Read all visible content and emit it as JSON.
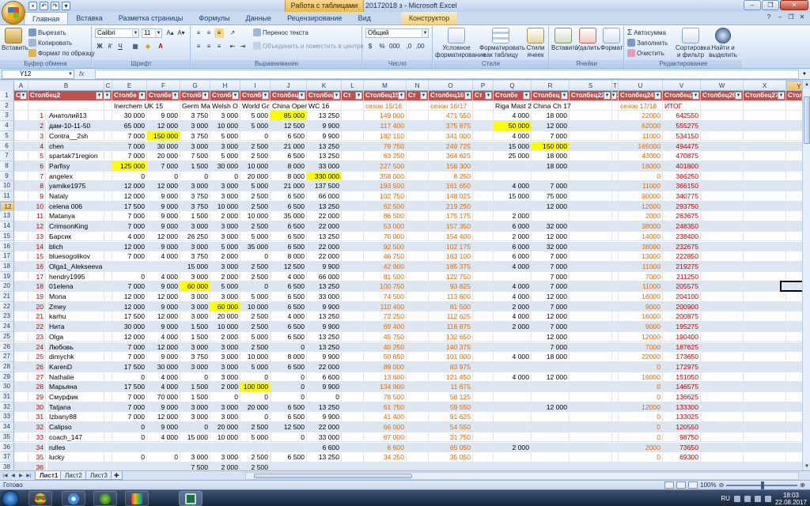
{
  "window": {
    "title": "20172018 з - Microsoft Excel",
    "context_tab_group": "Работа с таблицами"
  },
  "qat": [
    "save-icon",
    "undo-icon",
    "redo-icon",
    "dropdown-icon"
  ],
  "tabs": [
    {
      "label": "Главная",
      "active": true
    },
    {
      "label": "Вставка"
    },
    {
      "label": "Разметка страницы"
    },
    {
      "label": "Формулы"
    },
    {
      "label": "Данные"
    },
    {
      "label": "Рецензирование"
    },
    {
      "label": "Вид"
    },
    {
      "label": "Конструктор",
      "context": true
    }
  ],
  "ribbon": {
    "clipboard": {
      "title": "Буфер обмена",
      "paste": "Вставить",
      "cut": "Вырезать",
      "copy": "Копировать",
      "format_painter": "Формат по образцу"
    },
    "font": {
      "title": "Шрифт",
      "family": "Calibri",
      "size": "11",
      "bold": "Ж",
      "italic": "К",
      "underline": "Ч"
    },
    "alignment": {
      "title": "Выравнивание",
      "wrap": "Перенос текста",
      "merge": "Объединить и поместить в центре"
    },
    "number": {
      "title": "Число",
      "format": "Общий"
    },
    "styles": {
      "title": "Стили",
      "conditional": "Условное форматирование",
      "table": "Форматировать как таблицу",
      "cell_styles": "Стили ячеек"
    },
    "cells": {
      "title": "Ячейки",
      "insert": "Вставить",
      "delete": "Удалить",
      "format": "Формат"
    },
    "editing": {
      "title": "Редактирование",
      "autosum": "Автосумма",
      "fill": "Заполнить",
      "clear": "Очистить",
      "sort": "Сортировка и фильтр",
      "find": "Найти и выделить"
    }
  },
  "formula_bar": {
    "name_box": "Y12",
    "fx": "fx",
    "value": ""
  },
  "columns": [
    "A",
    "B",
    "C",
    "E",
    "F",
    "G",
    "H",
    "I",
    "J",
    "K",
    "L",
    "M",
    "N",
    "O",
    "P",
    "Q",
    "R",
    "S",
    "T",
    "U",
    "V",
    "W",
    "X",
    "Y"
  ],
  "header_row": [
    "Ст",
    "Столбец2",
    "С",
    "Столбе",
    "Столбе",
    "Столбе",
    "Столбе",
    "Столбе",
    "Столбец",
    "Столбец",
    "Ст",
    "Столбец15",
    "Ст",
    "Столбец16",
    "Ст",
    "Столбе",
    "Столбец",
    "Столбец22",
    "Ст",
    "Столбец24",
    "Столбец25",
    "Столбец26",
    "Столбец27",
    "Столб"
  ],
  "tournament_row": [
    "",
    "",
    "",
    "Inerchem UK 15",
    "",
    "Germ Ma",
    "Welsh O",
    "World Gr",
    "China Oper",
    "WC 16",
    "",
    "сезон 15/16",
    "",
    "сезон 16/17",
    "",
    "Riga Mast 2",
    "China Ch 17",
    "",
    "",
    "сезон 17/18",
    "ИТОГ",
    "",
    "",
    ""
  ],
  "rows": [
    {
      "n": "3",
      "id": "1",
      "name": "Анатолий13",
      "e": "30 000",
      "f": "9 000",
      "g": "3 750",
      "h": "3 000",
      "i": "5 000",
      "j": "85 000",
      "k": "13 250",
      "m": "149 000",
      "o": "471 550",
      "q": "4 000",
      "r": "18 000",
      "u": "22000",
      "v": "642550"
    },
    {
      "n": "4",
      "id": "2",
      "name": "дам-10-11-50",
      "e": "65 000",
      "f": "12 000",
      "g": "3 000",
      "h": "10 000",
      "i": "5 000",
      "j": "12 500",
      "k": "9 900",
      "m": "117 400",
      "o": "375 875",
      "q": "50 000",
      "r": "12 000",
      "u": "62000",
      "v": "555275"
    },
    {
      "n": "5",
      "id": "3",
      "name": "Contra__2sh",
      "e": "7 000",
      "f": "150 000",
      "g": "3 750",
      "h": "5 000",
      "i": "0",
      "j": "6 500",
      "k": "9 900",
      "m": "182 150",
      "o": "341 000",
      "q": "4 000",
      "r": "7 000",
      "u": "11000",
      "v": "534150"
    },
    {
      "n": "6",
      "id": "4",
      "name": "chen",
      "e": "7 000",
      "f": "30 000",
      "g": "3 000",
      "h": "3 000",
      "i": "2 500",
      "j": "21 000",
      "k": "13 250",
      "m": "79 750",
      "o": "249 725",
      "q": "15 000",
      "r": "150 000",
      "u": "165000",
      "v": "494475"
    },
    {
      "n": "7",
      "id": "5",
      "name": "spartak71region",
      "e": "7 000",
      "f": "20 000",
      "g": "7 500",
      "h": "5 000",
      "i": "2 500",
      "j": "6 500",
      "k": "13 250",
      "m": "63 250",
      "o": "364 625",
      "q": "25 000",
      "r": "18 000",
      "u": "43000",
      "v": "470875"
    },
    {
      "n": "8",
      "id": "6",
      "name": "Parfisy",
      "e": "125 000",
      "f": "7 000",
      "g": "1 500",
      "h": "30 000",
      "i": "10 000",
      "j": "8 000",
      "k": "33 000",
      "m": "227 500",
      "o": "156 300",
      "q": "",
      "r": "18 000",
      "u": "18000",
      "v": "401800"
    },
    {
      "n": "9",
      "id": "7",
      "name": "angelex",
      "e": "0",
      "f": "0",
      "g": "0",
      "h": "0",
      "i": "20 000",
      "j": "8 000",
      "k": "330 000",
      "m": "358 000",
      "o": "8 250",
      "q": "",
      "r": "",
      "u": "0",
      "v": "366250"
    },
    {
      "n": "10",
      "id": "8",
      "name": "yamike1975",
      "e": "12 000",
      "f": "12 000",
      "g": "3 000",
      "h": "3 000",
      "i": "5 000",
      "j": "21 000",
      "k": "137 500",
      "m": "193 500",
      "o": "161 650",
      "q": "4 000",
      "r": "7 000",
      "u": "11000",
      "v": "366150"
    },
    {
      "n": "11",
      "id": "9",
      "name": "Nataly",
      "e": "12 000",
      "f": "9 000",
      "g": "3 750",
      "h": "3 000",
      "i": "2 500",
      "j": "6 500",
      "k": "66 000",
      "m": "102 750",
      "o": "148 025",
      "q": "15 000",
      "r": "75 000",
      "u": "90000",
      "v": "340775"
    },
    {
      "n": "12",
      "id": "10",
      "name": "celena 006",
      "e": "17 500",
      "f": "9 000",
      "g": "3 750",
      "h": "10 000",
      "i": "2 500",
      "j": "6 500",
      "k": "13 250",
      "m": "62 500",
      "o": "219 250",
      "q": "",
      "r": "12 000",
      "u": "12000",
      "v": "293750"
    },
    {
      "n": "13",
      "id": "11",
      "name": "Matanya",
      "e": "7 000",
      "f": "9 000",
      "g": "1 500",
      "h": "2 000",
      "i": "10 000",
      "j": "35 000",
      "k": "22 000",
      "m": "86 500",
      "o": "175 175",
      "q": "2 000",
      "r": "",
      "u": "2000",
      "v": "263675"
    },
    {
      "n": "14",
      "id": "12",
      "name": "CrimsonKing",
      "e": "7 000",
      "f": "9 000",
      "g": "3 000",
      "h": "3 000",
      "i": "2 500",
      "j": "6 500",
      "k": "22 000",
      "m": "53 000",
      "o": "157 350",
      "q": "6 000",
      "r": "32 000",
      "u": "38000",
      "v": "248350"
    },
    {
      "n": "15",
      "id": "13",
      "name": "Барсик",
      "e": "4 000",
      "f": "12 000",
      "g": "26 250",
      "h": "3 000",
      "i": "5 000",
      "j": "6 500",
      "k": "13 250",
      "m": "70 000",
      "o": "154 400",
      "q": "2 000",
      "r": "12 000",
      "u": "14000",
      "v": "238400"
    },
    {
      "n": "16",
      "id": "14",
      "name": "blich",
      "e": "12 000",
      "f": "9 000",
      "g": "3 000",
      "h": "5 000",
      "i": "35 000",
      "j": "6 500",
      "k": "22 000",
      "m": "92 500",
      "o": "102 175",
      "q": "6 000",
      "r": "32 000",
      "u": "38000",
      "v": "232675"
    },
    {
      "n": "17",
      "id": "15",
      "name": "bluesogolikov",
      "e": "7 000",
      "f": "4 000",
      "g": "3 750",
      "h": "2 000",
      "i": "0",
      "j": "8 000",
      "k": "22 000",
      "m": "46 750",
      "o": "163 100",
      "q": "6 000",
      "r": "7 000",
      "u": "13000",
      "v": "222850"
    },
    {
      "n": "18",
      "id": "16",
      "name": "Olga1_Alekseeva",
      "e": "",
      "f": "",
      "g": "15 000",
      "h": "3 000",
      "i": "2 500",
      "j": "12 500",
      "k": "9 900",
      "m": "42 900",
      "o": "165 375",
      "q": "4 000",
      "r": "7 000",
      "u": "11000",
      "v": "219275"
    },
    {
      "n": "19",
      "id": "17",
      "name": "hendry1995",
      "e": "0",
      "f": "4 000",
      "g": "3 000",
      "h": "2 000",
      "i": "2 500",
      "j": "4 000",
      "k": "66 000",
      "m": "81 500",
      "o": "122 750",
      "q": "",
      "r": "7 000",
      "u": "7000",
      "v": "211250"
    },
    {
      "n": "20",
      "id": "18",
      "name": "01elena",
      "e": "7 000",
      "f": "9 000",
      "g": "60 000",
      "h": "5 000",
      "i": "0",
      "j": "6 500",
      "k": "13 250",
      "m": "100 750",
      "o": "93 825",
      "q": "4 000",
      "r": "7 000",
      "u": "11000",
      "v": "205575"
    },
    {
      "n": "21",
      "id": "19",
      "name": "Mona",
      "e": "12 000",
      "f": "12 000",
      "g": "3 000",
      "h": "3 000",
      "i": "5 000",
      "j": "6 500",
      "k": "33 000",
      "m": "74 500",
      "o": "113 600",
      "q": "4 000",
      "r": "12 000",
      "u": "16000",
      "v": "204100"
    },
    {
      "n": "22",
      "id": "20",
      "name": "Zmey",
      "e": "12 000",
      "f": "9 000",
      "g": "3 000",
      "h": "60 000",
      "i": "10 000",
      "j": "6 500",
      "k": "9 900",
      "m": "110 400",
      "o": "81 500",
      "q": "2 000",
      "r": "7 000",
      "u": "9000",
      "v": "200900"
    },
    {
      "n": "23",
      "id": "21",
      "name": "karhu",
      "e": "17 500",
      "f": "12 000",
      "g": "3 000",
      "h": "20 000",
      "i": "2 500",
      "j": "4 000",
      "k": "13 250",
      "m": "72 250",
      "o": "112 625",
      "q": "4 000",
      "r": "12 000",
      "u": "16000",
      "v": "200875"
    },
    {
      "n": "24",
      "id": "22",
      "name": "Нита",
      "e": "30 000",
      "f": "9 000",
      "g": "1 500",
      "h": "10 000",
      "i": "2 500",
      "j": "6 500",
      "k": "9 900",
      "m": "69 400",
      "o": "116 875",
      "q": "2 000",
      "r": "7 000",
      "u": "9000",
      "v": "195275"
    },
    {
      "n": "25",
      "id": "23",
      "name": "Olga",
      "e": "12 000",
      "f": "4 000",
      "g": "1 500",
      "h": "2 000",
      "i": "5 000",
      "j": "6 500",
      "k": "13 250",
      "m": "45 750",
      "o": "132 650",
      "q": "",
      "r": "12 000",
      "u": "12000",
      "v": "190400"
    },
    {
      "n": "26",
      "id": "24",
      "name": "Любовь",
      "e": "7 000",
      "f": "12 000",
      "g": "3 000",
      "h": "3 000",
      "i": "2 500",
      "j": "0",
      "k": "13 250",
      "m": "40 250",
      "o": "140 375",
      "q": "",
      "r": "7 000",
      "u": "7000",
      "v": "187625"
    },
    {
      "n": "27",
      "id": "25",
      "name": "dimychk",
      "e": "7 000",
      "f": "9 000",
      "g": "3 750",
      "h": "3 000",
      "i": "10 000",
      "j": "8 000",
      "k": "9 900",
      "m": "50 650",
      "o": "101 000",
      "q": "4 000",
      "r": "18 000",
      "u": "22000",
      "v": "173650"
    },
    {
      "n": "28",
      "id": "26",
      "name": "KarenD",
      "e": "17 500",
      "f": "30 000",
      "g": "3 000",
      "h": "3 000",
      "i": "5 000",
      "j": "6 500",
      "k": "22 000",
      "m": "89 000",
      "o": "83 975",
      "q": "",
      "r": "",
      "u": "0",
      "v": "172975"
    },
    {
      "n": "29",
      "id": "27",
      "name": "Nathalie",
      "e": "0",
      "f": "4 000",
      "g": "0",
      "h": "3 000",
      "i": "0",
      "j": "0",
      "k": "6 600",
      "m": "13 600",
      "o": "121 450",
      "q": "4 000",
      "r": "12 000",
      "u": "16000",
      "v": "151050"
    },
    {
      "n": "30",
      "id": "28",
      "name": "Марьяна",
      "e": "17 500",
      "f": "4 000",
      "g": "1 500",
      "h": "2 000",
      "i": "100 000",
      "j": "0",
      "k": "9 900",
      "m": "134 900",
      "o": "11 675",
      "q": "",
      "r": "",
      "u": "0",
      "v": "146575"
    },
    {
      "n": "31",
      "id": "29",
      "name": "Смурфик",
      "e": "7 000",
      "f": "70 000",
      "g": "1 500",
      "h": "0",
      "i": "0",
      "j": "0",
      "k": "0",
      "m": "78 500",
      "o": "58 125",
      "q": "",
      "r": "",
      "u": "0",
      "v": "136625"
    },
    {
      "n": "32",
      "id": "30",
      "name": "Tatjana",
      "e": "7 000",
      "f": "9 000",
      "g": "3 000",
      "h": "3 000",
      "i": "20 000",
      "j": "6 500",
      "k": "13 250",
      "m": "61 750",
      "o": "59 550",
      "q": "",
      "r": "12 000",
      "u": "12000",
      "v": "133300"
    },
    {
      "n": "33",
      "id": "31",
      "name": "Izbany88",
      "e": "7 000",
      "f": "12 000",
      "g": "3 000",
      "h": "3 000",
      "i": "0",
      "j": "6 500",
      "k": "9 900",
      "m": "41 400",
      "o": "91 625",
      "q": "",
      "r": "",
      "u": "0",
      "v": "133025"
    },
    {
      "n": "34",
      "id": "32",
      "name": "Calipso",
      "e": "0",
      "f": "9 000",
      "g": "0",
      "h": "20 000",
      "i": "2 500",
      "j": "12 500",
      "k": "22 000",
      "m": "66 000",
      "o": "54 550",
      "q": "",
      "r": "",
      "u": "0",
      "v": "120550"
    },
    {
      "n": "35",
      "id": "33",
      "name": "coach_147",
      "e": "0",
      "f": "4 000",
      "g": "15 000",
      "h": "10 000",
      "i": "5 000",
      "j": "0",
      "k": "33 000",
      "m": "67 000",
      "o": "31 750",
      "q": "",
      "r": "",
      "u": "0",
      "v": "98750"
    },
    {
      "n": "36",
      "id": "34",
      "name": "rulles",
      "e": "",
      "f": "",
      "g": "",
      "h": "",
      "i": "",
      "j": "",
      "k": "6 600",
      "m": "6 600",
      "o": "65 050",
      "q": "2 000",
      "r": "",
      "u": "2000",
      "v": "73650"
    },
    {
      "n": "37",
      "id": "35",
      "name": "lucky",
      "e": "0",
      "f": "0",
      "g": "3 000",
      "h": "3 000",
      "i": "2 500",
      "j": "6 500",
      "k": "13 250",
      "m": "34 250",
      "o": "35 050",
      "q": "",
      "r": "",
      "u": "0",
      "v": "69300"
    },
    {
      "n": "38",
      "id": "36",
      "name": "",
      "e": "",
      "f": "",
      "g": "7 500",
      "h": "2 000",
      "i": "2 500",
      "j": "",
      "k": "",
      "m": "",
      "o": "",
      "q": "",
      "r": "",
      "u": "",
      "v": ""
    }
  ],
  "highlights": {
    "3": [
      "j"
    ],
    "4": [
      "q"
    ],
    "5": [
      "f"
    ],
    "6": [
      "r"
    ],
    "8": [
      "e"
    ],
    "9": [
      "k"
    ],
    "20": [
      "g"
    ],
    "22": [
      "h"
    ],
    "30": [
      "i"
    ]
  },
  "sheets": [
    {
      "label": "Лист1",
      "active": true
    },
    {
      "label": "Лист2"
    },
    {
      "label": "Лист3"
    }
  ],
  "status": {
    "text": "Готово",
    "zoom": "100%"
  },
  "taskbar": {
    "lang": "RU",
    "time": "18:03",
    "date": "22.08.2017"
  }
}
